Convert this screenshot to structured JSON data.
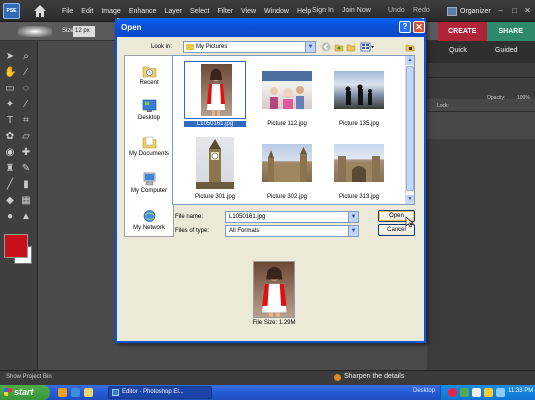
{
  "app": {
    "logo_text": "PSE",
    "menu": [
      "File",
      "Edit",
      "Image",
      "Enhance",
      "Layer",
      "Select",
      "Filter",
      "View",
      "Window",
      "Help"
    ],
    "sign_in": "Sign In",
    "join_now": "Join Now",
    "undo": "Undo",
    "redo": "Redo",
    "organizer": "Organizer",
    "options": {
      "size_label": "Size:",
      "size_value": "12 px"
    },
    "tabs": {
      "create": "CREATE",
      "share": "SHARE"
    },
    "edit_tabs": {
      "quick": "Quick",
      "guided": "Guided"
    },
    "layers": {
      "opacity_label": "Opacity:",
      "opacity_value": "100%",
      "lock_label": "Lock:"
    },
    "status": {
      "show_bin": "Show Project Bin",
      "tip": "Sharpen the details"
    },
    "colors": {
      "foreground": "#c8101a",
      "background": "#ffffff",
      "create_tab": "#b0243a",
      "share_tab": "#2f8a6c"
    }
  },
  "dialog": {
    "title": "Open",
    "help_label": "?",
    "close_label": "✕",
    "look_in_label": "Look in:",
    "look_in_value": "My Pictures",
    "places": [
      {
        "label": "Recent",
        "icon": "recent-folder-icon"
      },
      {
        "label": "Desktop",
        "icon": "desktop-icon"
      },
      {
        "label": "My Documents",
        "icon": "my-documents-icon"
      },
      {
        "label": "My Computer",
        "icon": "my-computer-icon"
      },
      {
        "label": "My Network",
        "icon": "my-network-icon"
      }
    ],
    "files": [
      {
        "name": "L1050161.jpg",
        "selected": true
      },
      {
        "name": "Picture 112.jpg",
        "selected": false
      },
      {
        "name": "Picture 135.jpg",
        "selected": false
      },
      {
        "name": "Picture 301.jpg",
        "selected": false
      },
      {
        "name": "Picture 302.jpg",
        "selected": false
      },
      {
        "name": "Picture 313.jpg",
        "selected": false
      }
    ],
    "file_name_label": "File name:",
    "file_name_value": "L1050161.jpg",
    "files_of_type_label": "Files of type:",
    "files_of_type_value": "All Formats",
    "open_button": "Open",
    "cancel_button": "Cancel",
    "file_size": "File Size: 1.29M"
  },
  "taskbar": {
    "start": "start",
    "task": "Editor - Photoshop El...",
    "desktop": "Desktop",
    "clock": "11:33 PM"
  }
}
